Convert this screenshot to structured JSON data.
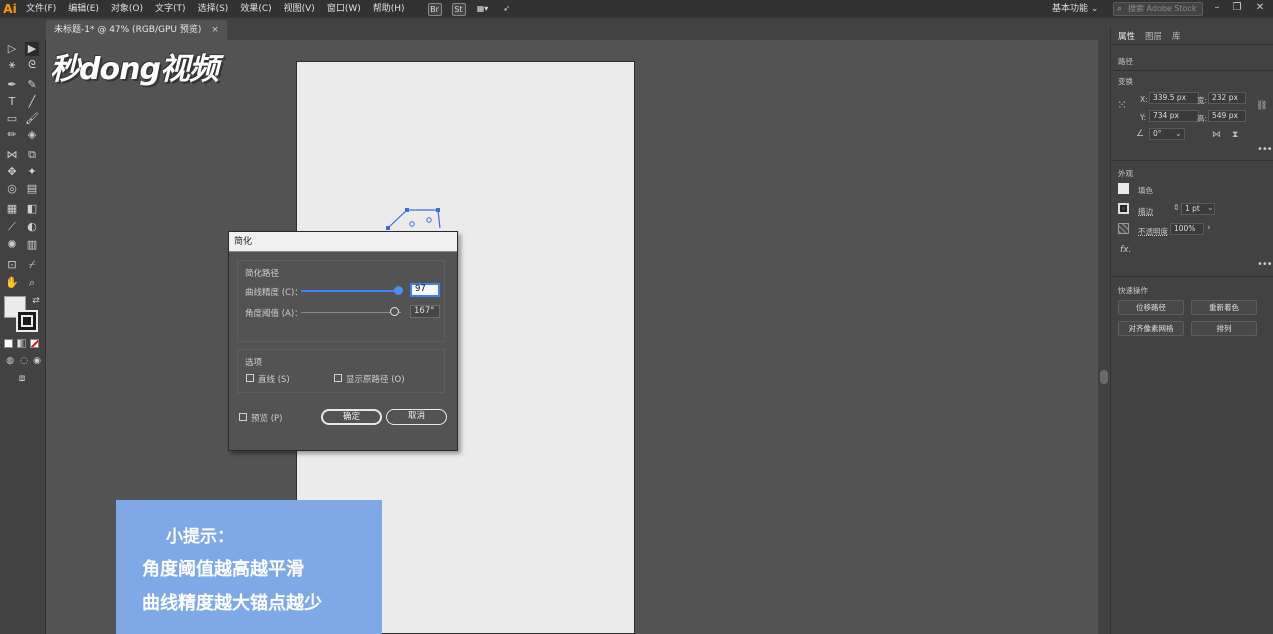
{
  "app": {
    "logo": "Ai",
    "menu": [
      "文件(F)",
      "编辑(E)",
      "对象(O)",
      "文字(T)",
      "选择(S)",
      "效果(C)",
      "视图(V)",
      "窗口(W)",
      "帮助(H)"
    ],
    "bar_icons": [
      "Br",
      "St"
    ],
    "workspace": "基本功能 ⌄",
    "stock_search_placeholder": "搜索 Adobe Stock",
    "window_buttons": [
      "–",
      "❐",
      "✕"
    ]
  },
  "document_tab": {
    "title": "未标题-1* @ 47% (RGB/GPU 预览)",
    "close": "×"
  },
  "watermark": "秒dong视频",
  "dialog": {
    "title": "简化",
    "section_path": "简化路径",
    "curve_precision_label": "曲线精度 (C)：",
    "curve_precision_value": "97",
    "curve_precision_fraction": 0.97,
    "angle_threshold_label": "角度阈值 (A)：",
    "angle_threshold_value": "167°",
    "angle_threshold_fraction": 0.93,
    "section_options": "选项",
    "straight_lines_label": "直线 (S)",
    "show_original_label": "显示原路径 (O)",
    "preview_label": "预览 (P)",
    "ok_label": "确定",
    "cancel_label": "取消"
  },
  "tip": {
    "title": "小提示：",
    "line1": "角度阈值越高越平滑",
    "line2": "曲线精度越大锚点越少"
  },
  "panel": {
    "tabs": [
      "属性",
      "图层",
      "库"
    ],
    "object_type": "路径",
    "transform_label": "变换",
    "x_label": "X:",
    "x_value": "339.5 px",
    "y_label": "Y:",
    "y_value": "734 px",
    "w_label": "宽:",
    "w_value": "232 px",
    "h_label": "高:",
    "h_value": "549 px",
    "angle_value": "0°",
    "appearance_label": "外观",
    "fill_label": "填色",
    "stroke_label": "描边",
    "stroke_value": "1 pt",
    "opacity_label": "不透明度",
    "opacity_value": "100%",
    "fx_label": "fx.",
    "quick_actions_label": "快速操作",
    "btn_offset_path": "位移路径",
    "btn_recolor": "重新着色",
    "btn_align_pixel": "对齐像素网格",
    "btn_arrange": "排列"
  }
}
